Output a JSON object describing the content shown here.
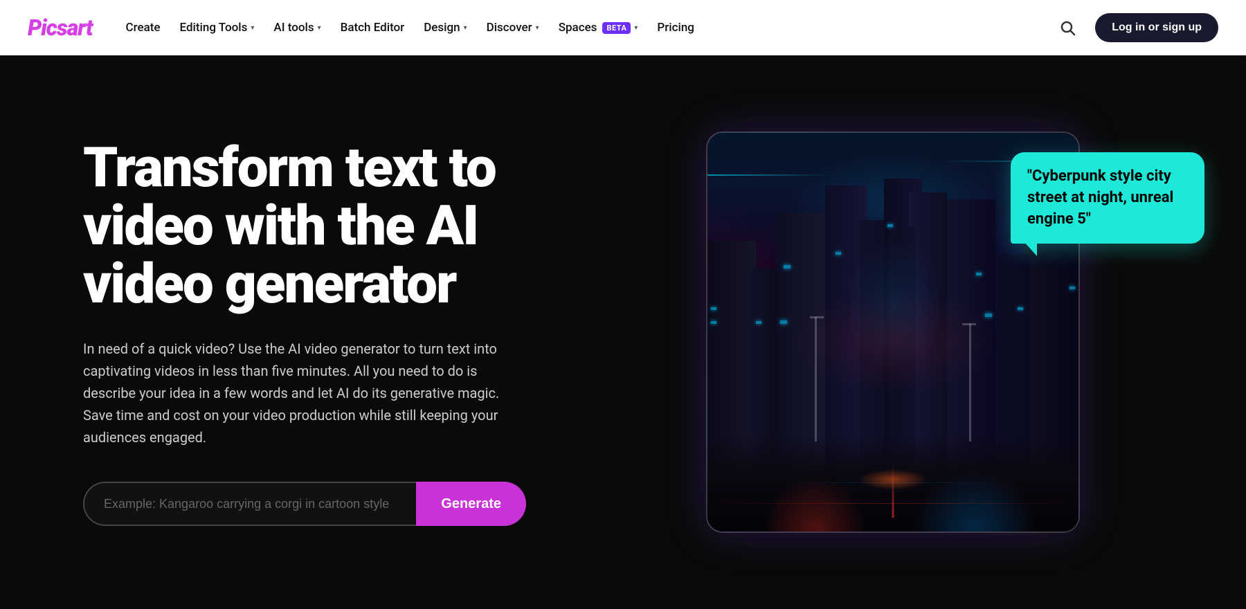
{
  "logo": {
    "text": "Picsart"
  },
  "nav": {
    "items": [
      {
        "label": "Create",
        "hasDropdown": false
      },
      {
        "label": "Editing Tools",
        "hasDropdown": true
      },
      {
        "label": "AI tools",
        "hasDropdown": true
      },
      {
        "label": "Batch Editor",
        "hasDropdown": false
      },
      {
        "label": "Design",
        "hasDropdown": true
      },
      {
        "label": "Discover",
        "hasDropdown": true
      },
      {
        "label": "Spaces",
        "hasDropdown": true,
        "badge": "BETA"
      },
      {
        "label": "Pricing",
        "hasDropdown": false
      }
    ]
  },
  "header": {
    "login_label": "Log in or sign up"
  },
  "hero": {
    "title": "Transform text to video with the AI video generator",
    "subtitle": "In need of a quick video? Use the AI video generator to turn text into captivating videos in less than five minutes. All you need to do is describe your idea in a few words and let AI do its generative magic. Save time and cost on your video production while still keeping your audiences engaged.",
    "input_placeholder": "Example: Kangaroo carrying a corgi in cartoon style",
    "generate_label": "Generate",
    "chat_bubble_text": "\"Cyberpunk style city street at night, unreal engine 5\""
  }
}
